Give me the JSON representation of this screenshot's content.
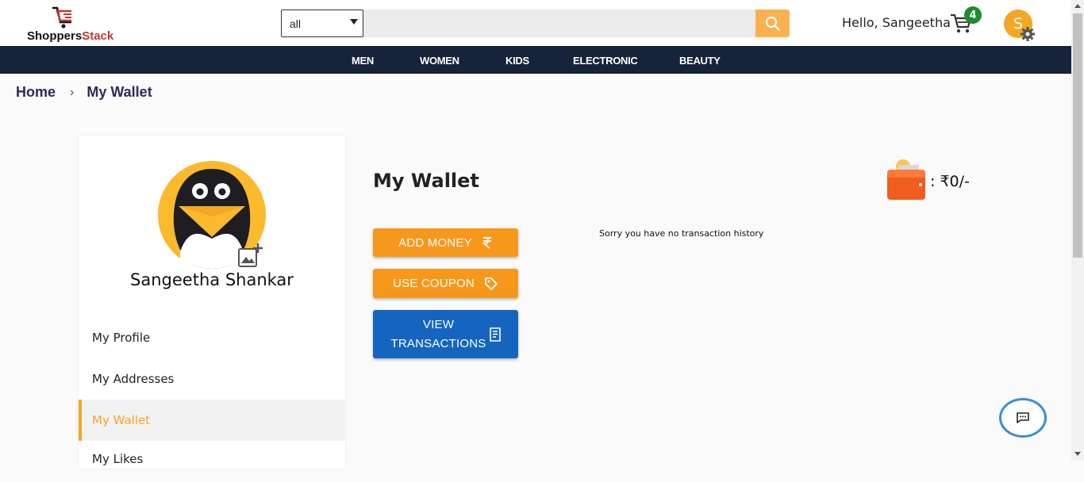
{
  "header": {
    "logo": {
      "name_part1": "Shoppers",
      "name_part2": "Stack"
    },
    "category_select": {
      "value": "all"
    },
    "search": {
      "placeholder": ""
    },
    "greeting": "Hello, Sangeetha",
    "cart_count": "4",
    "avatar_initial": "S"
  },
  "nav": {
    "items": [
      "MEN",
      "WOMEN",
      "KIDS",
      "ELECTRONIC",
      "BEAUTY"
    ]
  },
  "breadcrumb": {
    "home": "Home",
    "current": "My Wallet"
  },
  "sidebar": {
    "profile_name": "Sangeetha Shankar",
    "menu": [
      "My Profile",
      "My Addresses",
      "My Wallet",
      "My Likes"
    ],
    "active_item": "My Wallet"
  },
  "wallet": {
    "title": "My Wallet",
    "balance": ": ₹0/-",
    "add_money_label": "ADD MONEY",
    "use_coupon_label": "USE COUPON",
    "view_transactions_label_line1": "VIEW",
    "view_transactions_label_line2": "TRANSACTIONS",
    "empty_message": "Sorry you have no transaction history"
  },
  "colors": {
    "accent_orange": "#f7981d",
    "nav_bg": "#17233a",
    "blue_button": "#1565c0",
    "cart_badge": "#1e8c2e"
  }
}
